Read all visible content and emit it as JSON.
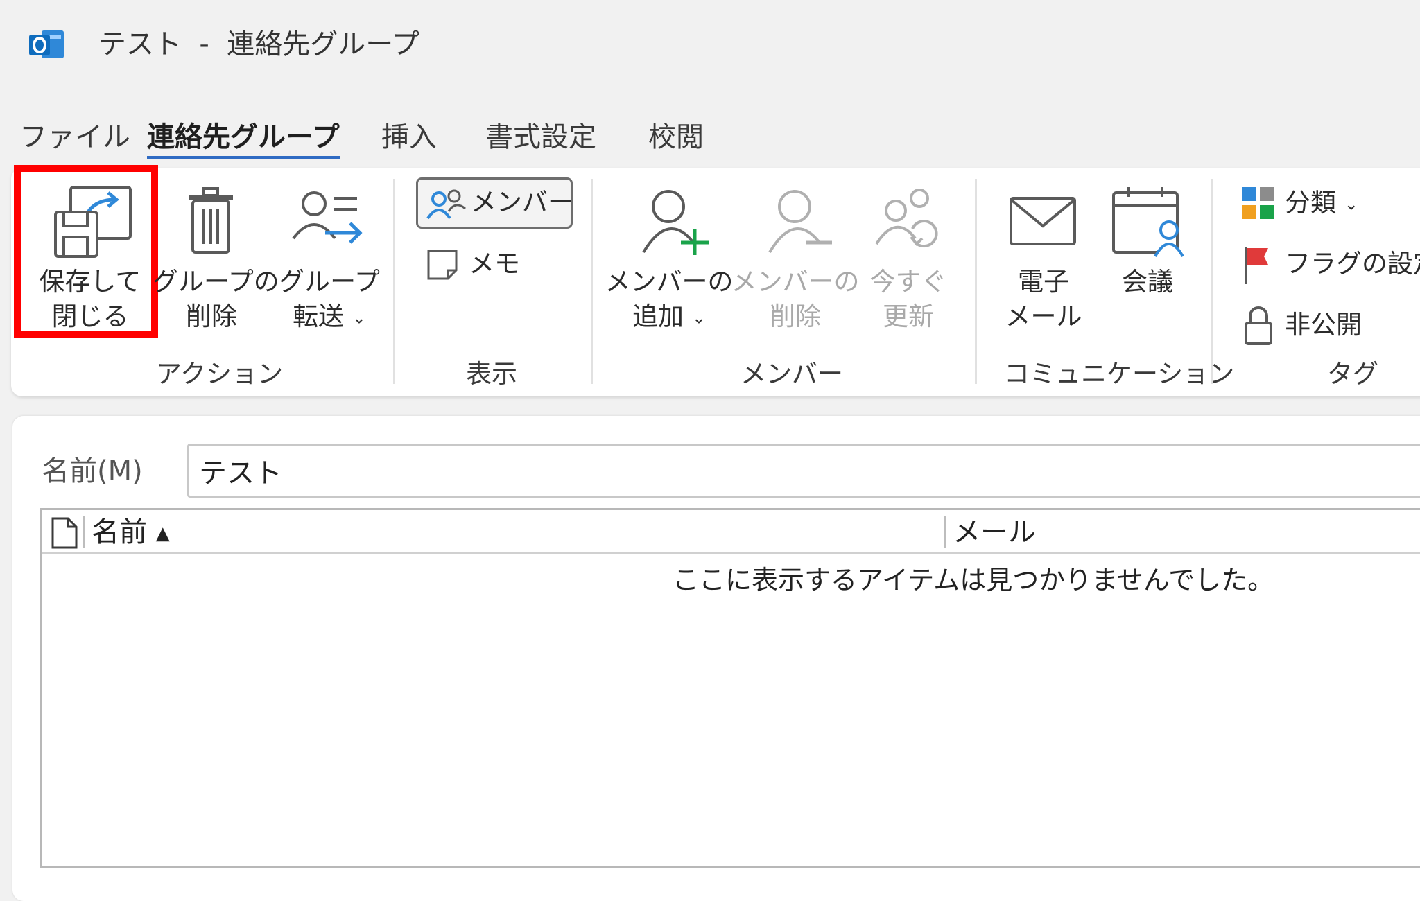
{
  "window": {
    "title": "テスト  -  連絡先グループ"
  },
  "tabs": [
    {
      "label": "ファイル"
    },
    {
      "label": "連絡先グループ",
      "active": true
    },
    {
      "label": "挿入"
    },
    {
      "label": "書式設定"
    },
    {
      "label": "校閲"
    }
  ],
  "ribbon": {
    "actions": {
      "group_label": "アクション",
      "save_close_line1": "保存して",
      "save_close_line2": "閉じる",
      "delete_group_line1": "グループの",
      "delete_group_line2": "削除",
      "forward_group_line1": "グループ",
      "forward_group_line2": "転送"
    },
    "show": {
      "group_label": "表示",
      "members_label": "メンバー",
      "notes_label": "メモ"
    },
    "members": {
      "group_label": "メンバー",
      "add_line1": "メンバーの",
      "add_line2": "追加",
      "remove_line1": "メンバーの",
      "remove_line2": "削除",
      "update_line1": "今すぐ",
      "update_line2": "更新"
    },
    "communicate": {
      "group_label": "コミュニケーション",
      "email_line1": "電子",
      "email_line2": "メール",
      "meeting_label": "会議"
    },
    "tags": {
      "group_label": "タグ",
      "categorize_label": "分類",
      "follow_up_label": "フラグの設定",
      "private_label": "非公開"
    }
  },
  "form": {
    "name_label": "名前(M)",
    "name_value": "テスト"
  },
  "member_list": {
    "columns": [
      {
        "label": "名前",
        "sort": "ascending"
      },
      {
        "label": "メール"
      }
    ],
    "empty_message": "ここに表示するアイテムは見つかりませんでした。"
  },
  "colors": {
    "accent": "#2f6bc3",
    "highlight": "#ff0000",
    "outlook_blue": "#0f6cbd",
    "green_plus": "#1aa34a",
    "flag_red": "#e03a3a"
  }
}
